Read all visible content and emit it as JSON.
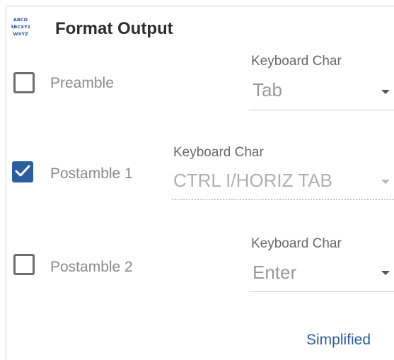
{
  "header": {
    "title": "Format Output",
    "icon": "abc-text-format-icon",
    "icon_lines": [
      "ABCD",
      "ABCXYZ",
      "WXYZ"
    ]
  },
  "rows": [
    {
      "label": "Preamble",
      "checked": false,
      "field_label": "Keyboard Char",
      "value": "Tab",
      "disabled": false
    },
    {
      "label": "Postamble 1",
      "checked": true,
      "field_label": "Keyboard Char",
      "value": "CTRL I/HORIZ TAB",
      "disabled": true
    },
    {
      "label": "Postamble 2",
      "checked": false,
      "field_label": "Keyboard Char",
      "value": "Enter",
      "disabled": false
    }
  ],
  "footer": {
    "link": "Simplified"
  },
  "colors": {
    "accent": "#2c5d9c",
    "checkbox_border": "#6d6d6d",
    "label_text": "#8a8a8a",
    "title_text": "#2e2e2e"
  }
}
